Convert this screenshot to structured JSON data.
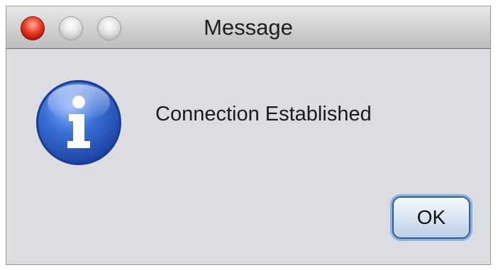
{
  "window": {
    "title": "Message",
    "controls": {
      "close_color": "#e8412c",
      "minimize_color": "#cfcfcf",
      "zoom_color": "#cfcfcf"
    }
  },
  "dialog": {
    "icon": "info-icon",
    "icon_color": "#2f5dc0",
    "message": "Connection Established",
    "ok_label": "OK"
  }
}
